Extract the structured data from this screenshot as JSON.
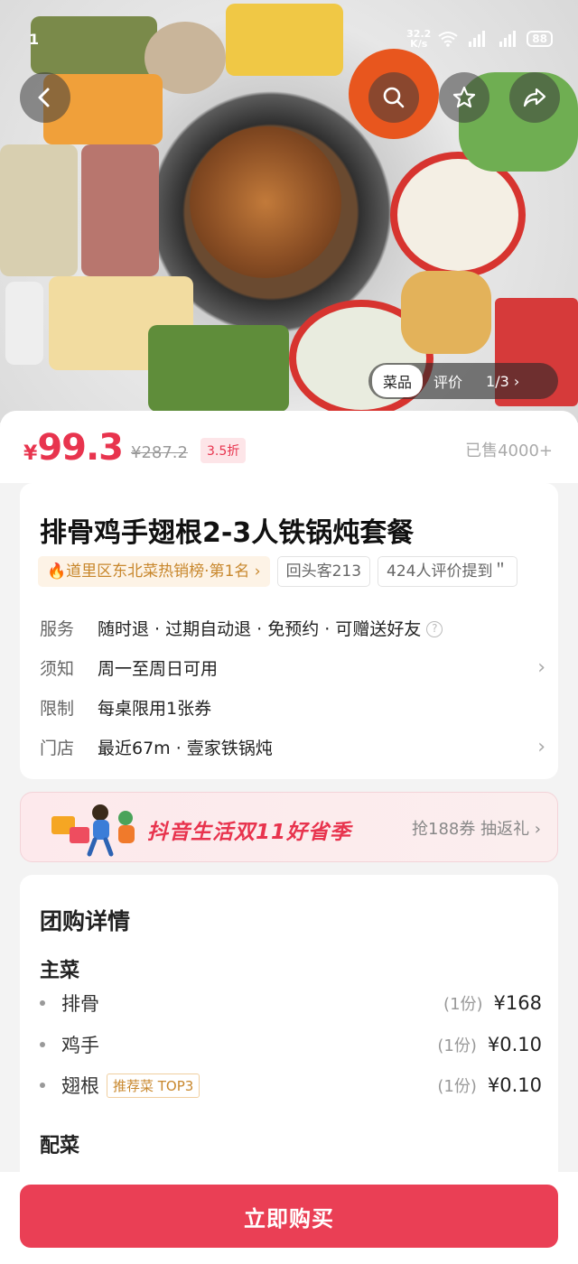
{
  "status_bar": {
    "time": "1",
    "speed_top": "32.2",
    "speed_bottom": "K/s",
    "battery": "88"
  },
  "gallery": {
    "tabs": [
      {
        "label": "菜品",
        "active": true
      },
      {
        "label": "评价",
        "active": false
      }
    ],
    "pager": "1/3 ›"
  },
  "price": {
    "currency": "¥",
    "amount": "99.3",
    "original": "¥287.2",
    "discount": "3.5折",
    "sold": "已售4000+"
  },
  "product": {
    "title": "排骨鸡手翅根2-3人铁锅炖套餐",
    "tags": [
      "🔥道里区东北菜热销榜·第1名 ›",
      "回头客213",
      "424人评价提到＂"
    ],
    "info": [
      {
        "key": "服务",
        "value": "随时退 · 过期自动退 · 免预约 · 可赠送好友",
        "help": "?"
      },
      {
        "key": "须知",
        "value": "周一至周日可用",
        "chevron": "›"
      },
      {
        "key": "限制",
        "value": "每桌限用1张券"
      },
      {
        "key": "门店",
        "value": "最近67m · 壹家铁锅炖",
        "chevron": "›"
      }
    ]
  },
  "promo": {
    "title": "抖音生活双11好省季",
    "right": "抢188券 抽返礼 ›"
  },
  "detail": {
    "title": "团购详情",
    "sections": [
      {
        "title": "主菜",
        "items": [
          {
            "name": "排骨",
            "qty": "(1份)",
            "price": "¥168"
          },
          {
            "name": "鸡手",
            "qty": "(1份)",
            "price": "¥0.10"
          },
          {
            "name": "翅根",
            "badge": "推荐菜 TOP3",
            "qty": "(1份)",
            "price": "¥0.10"
          }
        ]
      },
      {
        "title": "配菜",
        "items": []
      }
    ]
  },
  "buy_button": "立即购买",
  "colors": {
    "accent": "#ea3f55",
    "price": "#e8344e",
    "tag_rank": "#c8872c"
  }
}
